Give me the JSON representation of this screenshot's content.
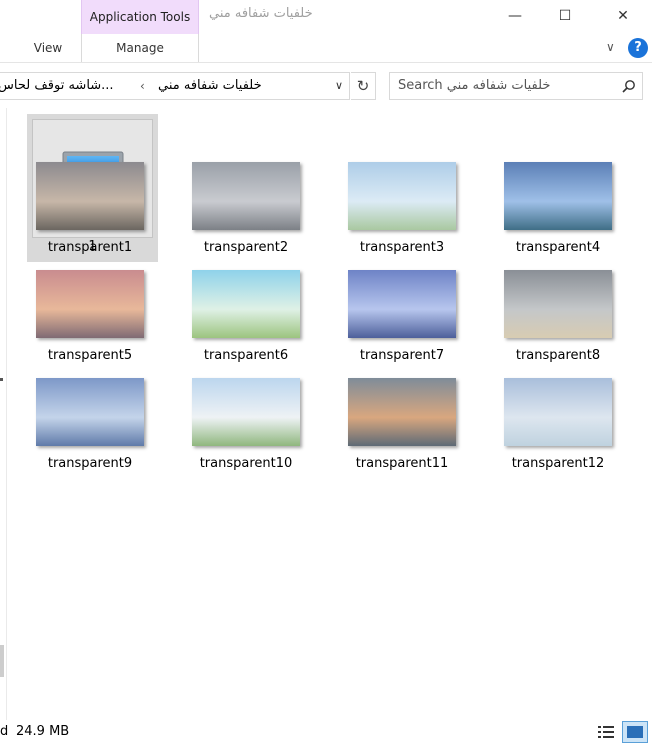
{
  "window": {
    "title": "خلفيات شفافه مني",
    "context_group": "Application Tools",
    "minimize_glyph": "—",
    "maximize_glyph": "☐",
    "close_glyph": "✕"
  },
  "ribbon": {
    "tabs": [
      {
        "label": "View"
      },
      {
        "label": "Manage"
      }
    ],
    "collapse_glyph": "∨",
    "help_glyph": "?"
  },
  "address": {
    "crumbs": [
      "خلفيات شفافه مني",
      "...شاشه توقف لحاس"
    ],
    "separator": "‹",
    "dropdown_glyph": "∨",
    "refresh_glyph": "↻"
  },
  "search": {
    "placeholder": "Search خلفيات شفافه مني",
    "icon": "search-icon"
  },
  "items": [
    {
      "label": "1",
      "kind": "folder",
      "icon": "monitor-icon"
    },
    {
      "label": "transparent1",
      "kind": "image"
    },
    {
      "label": "transparent2",
      "kind": "image"
    },
    {
      "label": "transparent3",
      "kind": "image"
    },
    {
      "label": "transparent4",
      "kind": "image"
    },
    {
      "label": "transparent5",
      "kind": "image"
    },
    {
      "label": "transparent6",
      "kind": "image"
    },
    {
      "label": "transparent7",
      "kind": "image"
    },
    {
      "label": "transparent8",
      "kind": "image"
    },
    {
      "label": "transparent9",
      "kind": "image"
    },
    {
      "label": "transparent10",
      "kind": "image"
    },
    {
      "label": "transparent11",
      "kind": "image"
    },
    {
      "label": "transparent12",
      "kind": "image"
    }
  ],
  "status": {
    "fragment": "d",
    "size": "24.9 MB"
  },
  "colors": {
    "context_tab_bg": "#f1dcfb",
    "selected_tile_bg": "#d9d9d9",
    "help_blue": "#1a73d9"
  }
}
